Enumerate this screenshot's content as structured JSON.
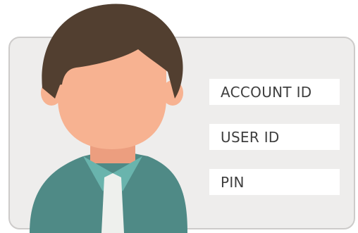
{
  "fields": [
    {
      "label": "ACCOUNT ID"
    },
    {
      "label": "USER ID"
    },
    {
      "label": "PIN"
    }
  ],
  "colors": {
    "card_background": "#eeedec",
    "card_border": "#cdcbca",
    "field_background": "#ffffff",
    "text": "#3f3f3f",
    "hair": "#523f30",
    "skin": "#f7b291",
    "jacket": "#4f8a86",
    "collar": "#69b4ad",
    "shirt": "#eef0ed"
  },
  "icons": {
    "avatar": "person-avatar-icon"
  }
}
